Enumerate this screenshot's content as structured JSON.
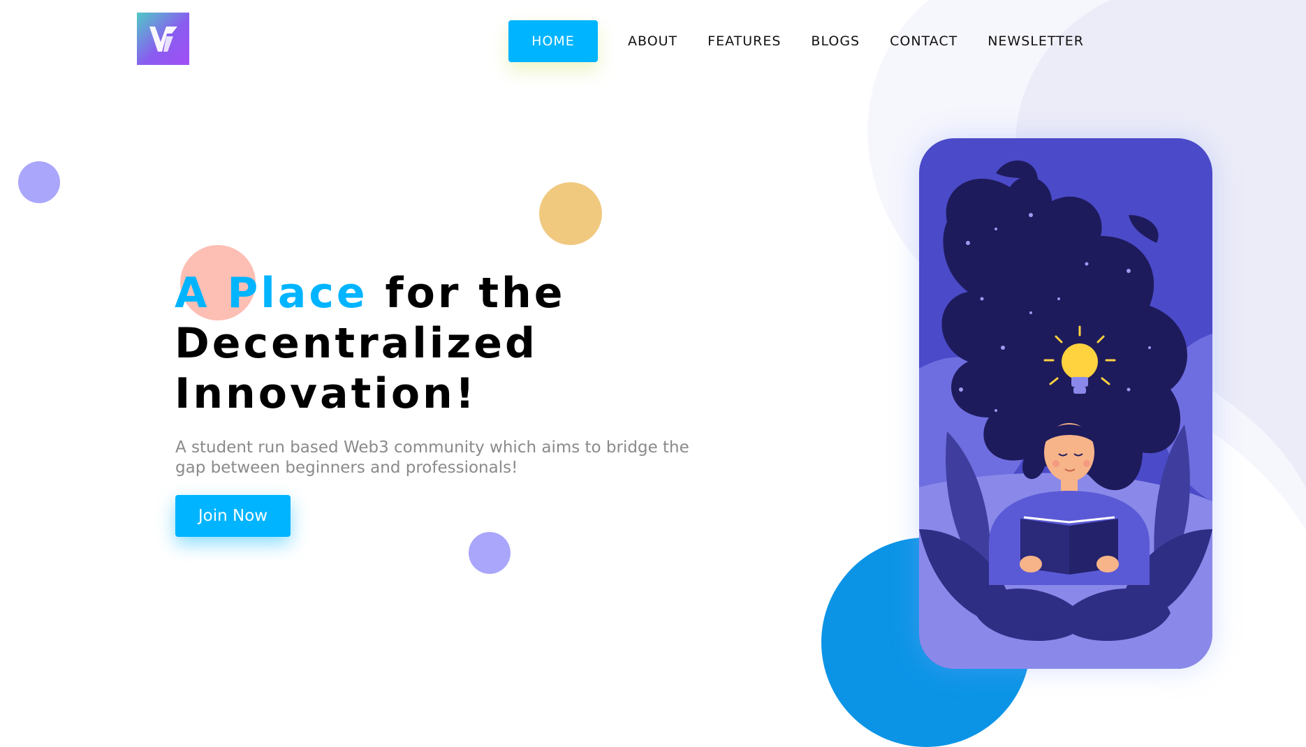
{
  "header": {
    "logo_alt": "Web3 community logo",
    "nav": [
      {
        "label": "HOME",
        "active": true
      },
      {
        "label": "ABOUT",
        "active": false
      },
      {
        "label": "FEATURES",
        "active": false
      },
      {
        "label": "BLOGS",
        "active": false
      },
      {
        "label": "CONTACT",
        "active": false
      },
      {
        "label": "NEWSLETTER",
        "active": false
      }
    ]
  },
  "hero": {
    "title_accent": "A Place",
    "title_rest_line1": " for the",
    "title_line2": "Decentralized",
    "title_line3": "Innovation!",
    "subtitle": "A student run based Web3 community which aims to bridge the gap between beginners and professionals!",
    "cta_label": "Join Now"
  },
  "illustration": {
    "icon": "lightbulb-woman-reading-illustration"
  },
  "colors": {
    "accent": "#00b4ff",
    "purple_circle": "#aaa6fb",
    "yellow_circle": "#f0c97f",
    "pink_circle": "#fdbeb3",
    "card_bg": "#4b4ac8"
  }
}
